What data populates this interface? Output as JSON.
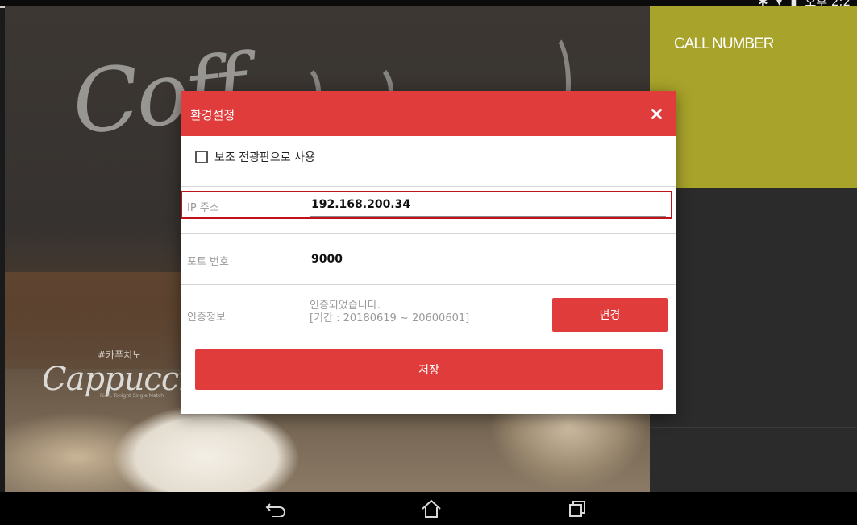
{
  "status_bar": {
    "time": "오후 2:2"
  },
  "background": {
    "coffee_text": "Coff",
    "cappuccino_korean": "#카푸치노",
    "cappuccino_text": "Cappuccino",
    "cappuccino_sub": "Rich, Tonight Single Match"
  },
  "right_panel": {
    "call_title": "CALL NUMBER"
  },
  "dialog": {
    "title": "환경설정",
    "close_icon": "close-icon",
    "use_as_sub_display_label": "보조 전광판으로 사용",
    "use_as_sub_display_checked": false,
    "ip_label": "IP 주소",
    "ip_value": "192.168.200.34",
    "port_label": "포트 번호",
    "port_value": "9000",
    "auth_label": "인증정보",
    "auth_status": "인증되었습니다.",
    "auth_period": "[기간 : 20180619 ~ 20600601]",
    "change_button": "변경",
    "save_button": "저장"
  },
  "colors": {
    "accent": "#e03c3c",
    "call_panel": "#a8a32a",
    "highlight": "#c0121a"
  },
  "nav": {
    "back_icon": "back-icon",
    "home_icon": "home-icon",
    "recents_icon": "recents-icon"
  }
}
